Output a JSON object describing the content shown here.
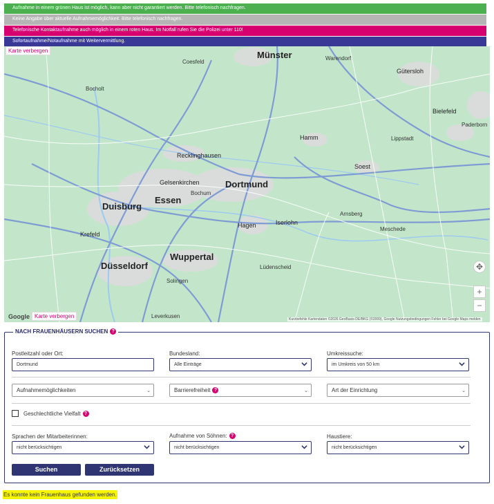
{
  "banners": [
    {
      "text": "Aufnahme in einem grünen Haus ist möglich, kann aber nicht garantiert werden. Bitte telefonisch nachfragen.",
      "color": "#4caf50"
    },
    {
      "text": "Keine Angabe über aktuelle Aufnahmemöglichkeit. Bitte telefonisch nachfragen.",
      "color": "#b5b5b5"
    },
    {
      "text": "Telefonische Kontaktaufnahme auch möglich in einem roten Haus. Im Notfall rufen Sie die Polizei unter 110!",
      "color": "#d6006e"
    },
    {
      "text": "Sofortaufnahme/Notaufnahme mit Weitervermittlung.",
      "color": "#3a3896"
    }
  ],
  "map": {
    "hide_map_top": "Karte verbergen",
    "hide_map_bottom": "Karte verbergen",
    "google": "Google",
    "footer": "Kurzbefehle   Kartendaten ©2026 GeoBasis-DE/BKG (©2009), Google   Nutzungsbedingungen   Fehler bei Google Maps melden",
    "zoom_in": "+",
    "zoom_out": "−",
    "cities_big": [
      "Münster",
      "Dortmund",
      "Duisburg",
      "Essen",
      "Düsseldorf",
      "Wuppertal"
    ],
    "cities": [
      "Gütersloh",
      "Bielefeld",
      "Lippstadt",
      "Hamm",
      "Soest",
      "Gelsenkirchen",
      "Bochum",
      "Hagen",
      "Iserlohn",
      "Recklinghausen",
      "Krefeld",
      "Solingen",
      "Lüdenscheid",
      "Paderborn",
      "Coesfeld",
      "Bocholt",
      "Arnsberg",
      "Warendorf",
      "Meschede",
      "Leverkusen"
    ]
  },
  "search": {
    "title": "NACH FRAUENHÄUSERN SUCHEN",
    "plz_label": "Postleitzahl oder Ort:",
    "plz_value": "Dortmund",
    "bundesland_label": "Bundesland:",
    "bundesland_value": "Alle Einträge",
    "umkreis_label": "Umkreissuche:",
    "umkreis_value": "im Umkreis von 50 km",
    "aufnahme_value": "Aufnahmemöglichkeiten",
    "barriere_value": "Barrierefreiheit",
    "art_value": "Art der Einrichtung",
    "vielfalt_label": "Geschlechtliche Vielfalt",
    "sprachen_label": "Sprachen der Mitarbeiterinnen:",
    "sprachen_value": "nicht berücksichtigen",
    "soehne_label": "Aufnahme von Söhnen:",
    "soehne_value": "nicht berücksichtigen",
    "haustiere_label": "Haustiere:",
    "haustiere_value": "nicht berücksichtigen",
    "search_button": "Suchen",
    "reset_button": "Zurücksetzen",
    "help_icon": "?"
  },
  "result_text": "Es konnte kein Frauenhaus gefunden werden."
}
